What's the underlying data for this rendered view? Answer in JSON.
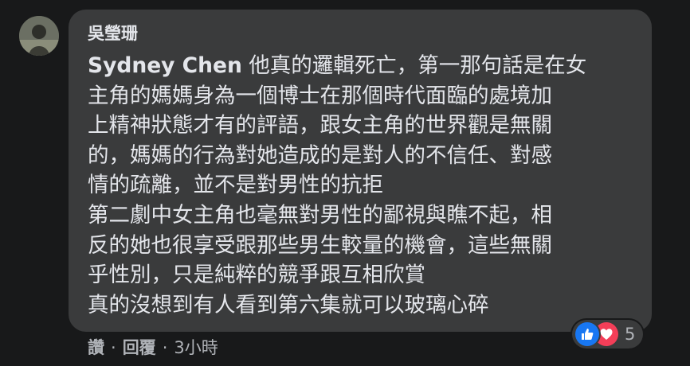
{
  "comment": {
    "author": "吳瑩珊",
    "mention": "Sydney Chen",
    "lines": [
      " 他真的邏輯死亡，第一那句話是在女",
      "主角的媽媽身為一個博士在那個時代面臨的處境加",
      "上精神狀態才有的評語，跟女主角的世界觀是無關",
      "的，媽媽的行為對她造成的是對人的不信任、對感",
      "情的疏離，並不是對男性的抗拒",
      "第二劇中女主角也毫無對男性的鄙視與瞧不起，相",
      "反的她也很享受跟那些男生較量的機會，這些無關",
      "乎性別，只是純粹的競爭跟互相欣賞",
      "真的沒想到有人看到第六集就可以玻璃心碎"
    ]
  },
  "reactions": {
    "icons": [
      "like-icon",
      "love-icon"
    ],
    "count": "5",
    "colors": {
      "like": "#1877f2",
      "love": "#f33e58"
    }
  },
  "actions": {
    "like_label": "讚",
    "reply_label": "回覆",
    "separator": "·",
    "timestamp": "3小時"
  },
  "theme": {
    "background": "#18191a",
    "bubble": "#3a3b3c",
    "text": "#e4e6eb",
    "secondary_text": "#b0b3b8"
  }
}
